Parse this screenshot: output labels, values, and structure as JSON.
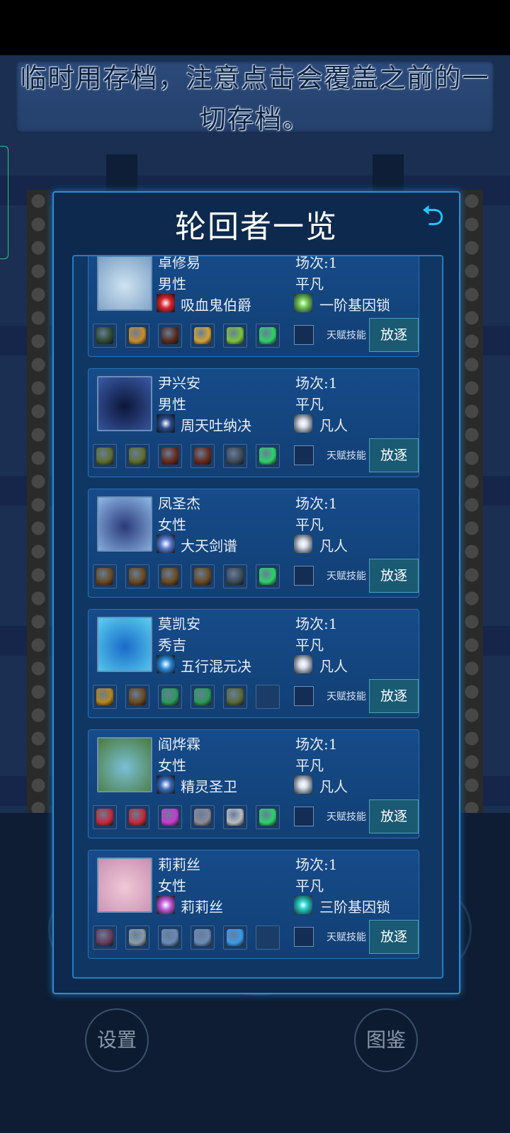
{
  "notice": {
    "line1": "临时用存档，注意点击会覆盖之前的一",
    "line2": "切存档。"
  },
  "panel": {
    "title": "轮回者一览",
    "back_icon": "back-arrow-icon"
  },
  "labels": {
    "talent": "天赋技能",
    "exile": "放逐"
  },
  "characters": [
    {
      "name": "卓修易",
      "gender": "男性",
      "skill": "吸血鬼伯爵",
      "round": "场次:1",
      "rank": "平凡",
      "lock": "一阶基因锁",
      "avatar_colors": [
        "#cfe3f2",
        "#7a9fc4"
      ],
      "skill_color": "#d8262e",
      "lock_color": "#7bd35a",
      "items": [
        "#2e4a2e",
        "#c98c2a",
        "#5a2a1a",
        "#d4a234",
        "#7ac43c",
        "#2fd06a"
      ]
    },
    {
      "name": "尹兴安",
      "gender": "男性",
      "skill": "周天吐纳决",
      "round": "场次:1",
      "rank": "平凡",
      "lock": "凡人",
      "avatar_colors": [
        "#0c1638",
        "#3a5aa8"
      ],
      "skill_color": "#2b4a8c",
      "lock_color": "#d8dde6",
      "items": [
        "#5f6e2e",
        "#5f6e2e",
        "#6a2a1a",
        "#6a2a1a",
        "#3d4a58",
        "#2fd06a"
      ]
    },
    {
      "name": "凤圣杰",
      "gender": "女性",
      "skill": "大天剑谱",
      "round": "场次:1",
      "rank": "平凡",
      "lock": "凡人",
      "avatar_colors": [
        "#2a3a7a",
        "#8fb8e6"
      ],
      "skill_color": "#5a7ad0",
      "lock_color": "#d8dde6",
      "items": [
        "#6a4a22",
        "#6a4a22",
        "#6a4a22",
        "#6a4a22",
        "#3d4a58",
        "#2fd06a"
      ]
    },
    {
      "name": "莫凯安",
      "gender": "秀吉",
      "skill": "五行混元决",
      "round": "场次:1",
      "rank": "平凡",
      "lock": "凡人",
      "avatar_colors": [
        "#1a6ac8",
        "#5ad0f0"
      ],
      "skill_color": "#2a8ad8",
      "lock_color": "#d8dde6",
      "items": [
        "#b8861c",
        "#6a4a22",
        "#2a9a5a",
        "#2a9a5a",
        "#5a6a3a",
        ""
      ]
    },
    {
      "name": "阎烨霖",
      "gender": "女性",
      "skill": "精灵圣卫",
      "round": "场次:1",
      "rank": "平凡",
      "lock": "凡人",
      "avatar_colors": [
        "#7ac0d8",
        "#4a7a3a"
      ],
      "skill_color": "#3a6ab8",
      "lock_color": "#d8dde6",
      "items": [
        "#c8283a",
        "#c8283a",
        "#c83ad0",
        "#8a8a9a",
        "#b8bcc4",
        "#2fd06a"
      ]
    },
    {
      "name": "莉莉丝",
      "gender": "女性",
      "skill": "莉莉丝",
      "round": "场次:1",
      "rank": "平凡",
      "lock": "三阶基因锁",
      "avatar_colors": [
        "#f0c8d8",
        "#c890b0"
      ],
      "skill_color": "#c05ad8",
      "lock_color": "#2ad8d0",
      "items": [
        "#6a3a5a",
        "#8a9aa8",
        "#6a8ab8",
        "#6a8ab8",
        "#3a9ae8",
        ""
      ]
    }
  ],
  "bottom": {
    "settings": "设置",
    "codex": "图鉴"
  }
}
